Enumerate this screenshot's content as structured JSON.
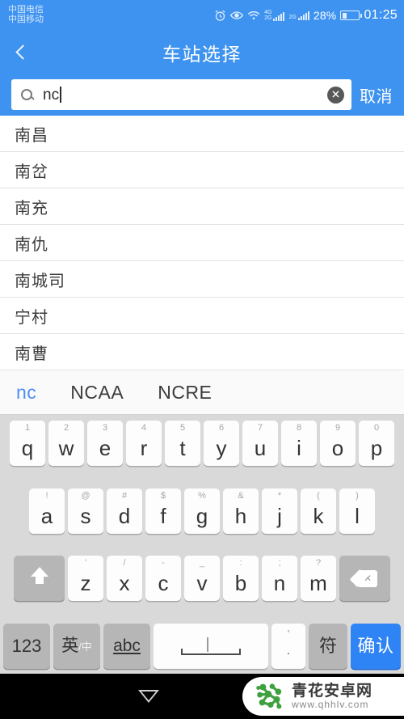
{
  "statusbar": {
    "carrier_line1": "中国电信",
    "carrier_line2": "中国移动",
    "icons": [
      "alarm-icon",
      "eye-icon",
      "wifi-icon"
    ],
    "signal1_top": "4G",
    "signal1_bottom": "2G",
    "signal2_label": "2G",
    "battery_percent": "28%",
    "time": "01:25"
  },
  "header": {
    "back_icon": "chevron-left-icon",
    "title": "车站选择"
  },
  "search": {
    "icon": "search-icon",
    "value": "nc",
    "placeholder": "",
    "clear_icon": "clear-circle-icon",
    "cancel_label": "取消"
  },
  "results": {
    "items": [
      {
        "name": "南昌"
      },
      {
        "name": "南岔"
      },
      {
        "name": "南充"
      },
      {
        "name": "南仇"
      },
      {
        "name": "南城司"
      },
      {
        "name": "宁村"
      },
      {
        "name": "南曹"
      }
    ]
  },
  "candidates": {
    "items": [
      {
        "text": "nc",
        "active": true
      },
      {
        "text": "NCAA",
        "active": false
      },
      {
        "text": "NCRE",
        "active": false
      }
    ]
  },
  "keyboard": {
    "row1": [
      {
        "sub": "1",
        "main": "q"
      },
      {
        "sub": "2",
        "main": "w"
      },
      {
        "sub": "3",
        "main": "e"
      },
      {
        "sub": "4",
        "main": "r"
      },
      {
        "sub": "5",
        "main": "t"
      },
      {
        "sub": "6",
        "main": "y"
      },
      {
        "sub": "7",
        "main": "u"
      },
      {
        "sub": "8",
        "main": "i"
      },
      {
        "sub": "9",
        "main": "o"
      },
      {
        "sub": "0",
        "main": "p"
      }
    ],
    "row2": [
      {
        "sub": "!",
        "main": "a"
      },
      {
        "sub": "@",
        "main": "s"
      },
      {
        "sub": "#",
        "main": "d"
      },
      {
        "sub": "$",
        "main": "f"
      },
      {
        "sub": "%",
        "main": "g"
      },
      {
        "sub": "&",
        "main": "h"
      },
      {
        "sub": "*",
        "main": "j"
      },
      {
        "sub": "(",
        "main": "k"
      },
      {
        "sub": ")",
        "main": "l"
      }
    ],
    "row3": {
      "shift_icon": "shift-arrow-icon",
      "keys": [
        {
          "sub": "'",
          "main": "z"
        },
        {
          "sub": "/",
          "main": "x"
        },
        {
          "sub": "-",
          "main": "c"
        },
        {
          "sub": "_",
          "main": "v"
        },
        {
          "sub": ":",
          "main": "b"
        },
        {
          "sub": ";",
          "main": "n"
        },
        {
          "sub": "?",
          "main": "m"
        }
      ],
      "backspace_icon": "backspace-icon"
    },
    "row4": {
      "numeric_label": "123",
      "lang_label": "英",
      "lang_sub": "/中",
      "abc_label": "abc",
      "space_icon": "microphone-icon",
      "punct_sub": "'",
      "punct_main": "·",
      "symbol_label": "符",
      "enter_label": "确认"
    }
  },
  "navbar": {
    "back_icon": "nav-back-triangle-icon",
    "home_icon": "nav-home-circle-icon",
    "watermark_title": "青花安卓网",
    "watermark_url": "www.qhhlv.com",
    "watermark_logo": "molecule-logo-icon"
  }
}
